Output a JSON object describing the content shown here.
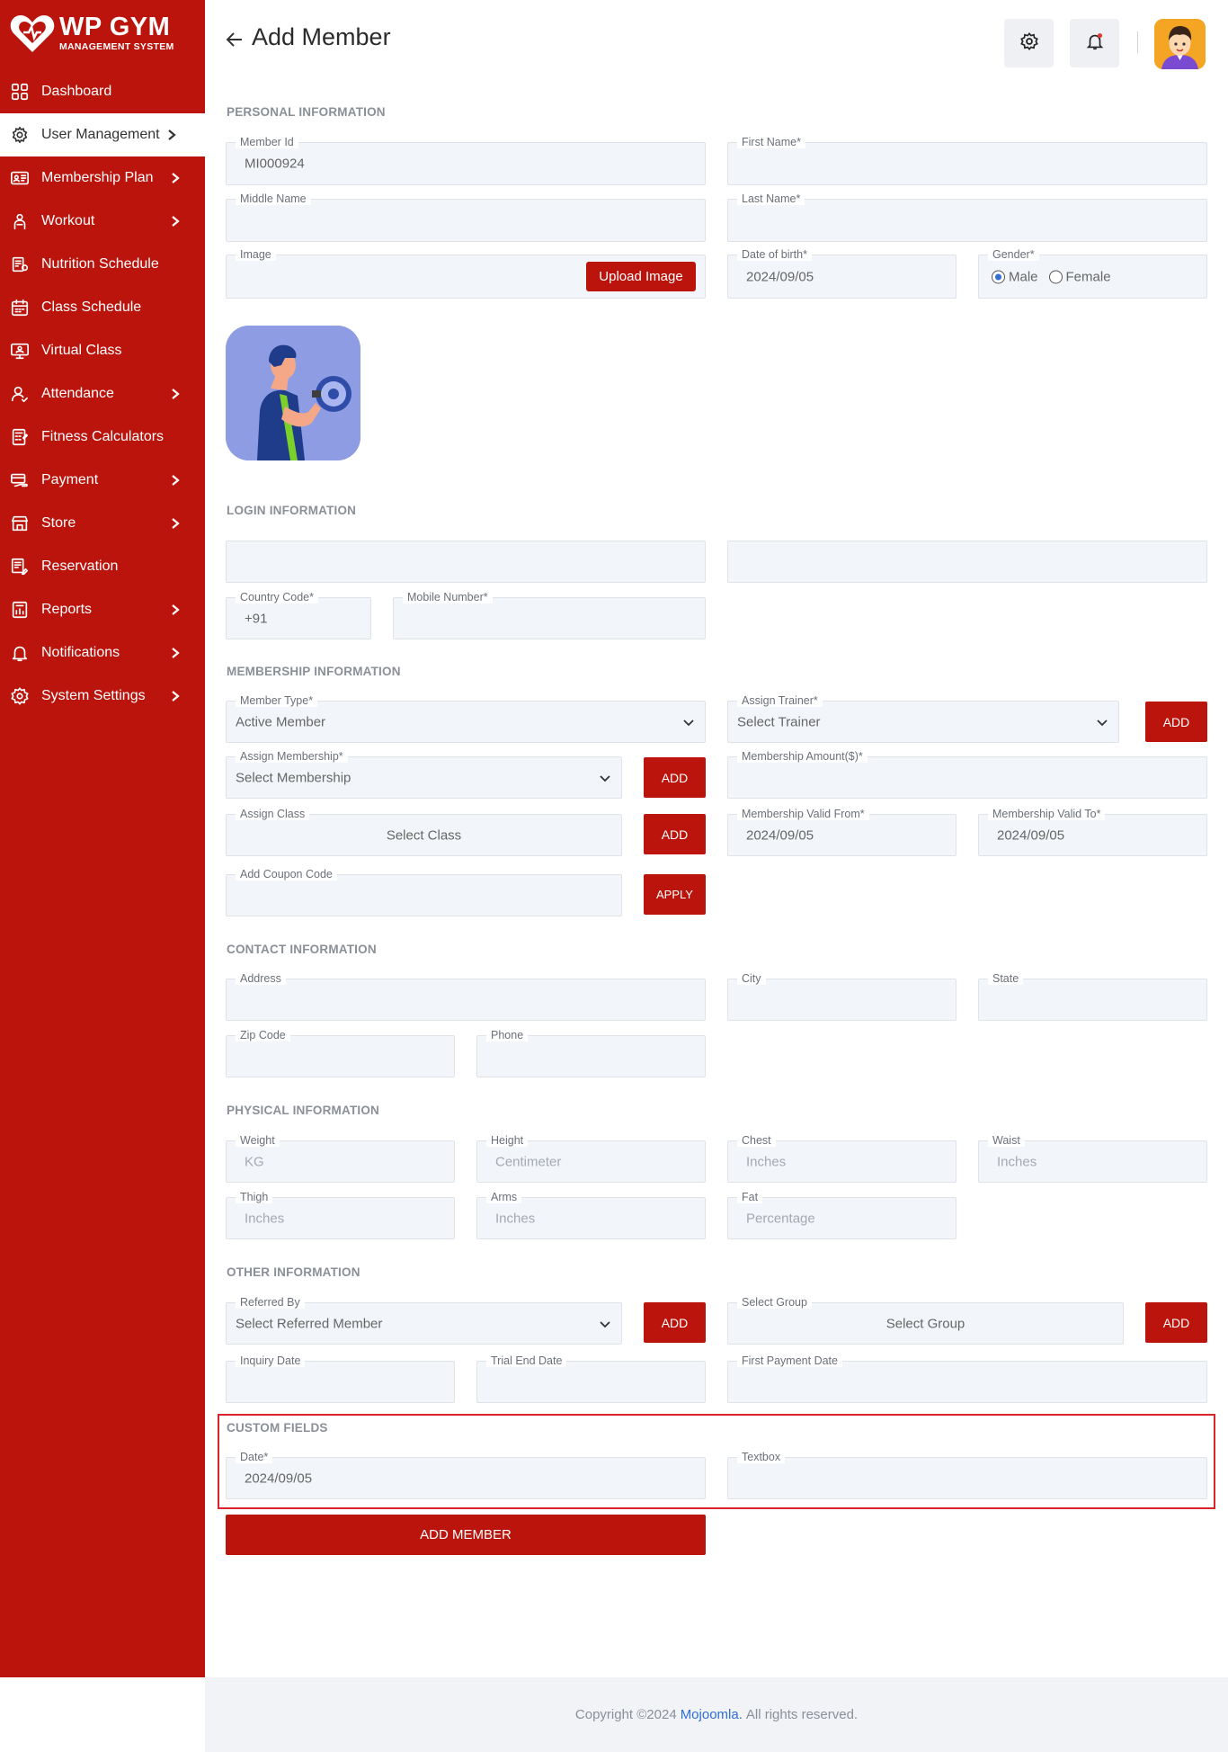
{
  "brand": {
    "title": "WP GYM",
    "subtitle": "MANAGEMENT SYSTEM"
  },
  "sidebar": {
    "items": [
      {
        "label": "Dashboard",
        "icon": "dashboard-icon",
        "chevron": false,
        "active": false
      },
      {
        "label": "User Management",
        "icon": "users-gear-icon",
        "chevron": true,
        "active": true
      },
      {
        "label": "Membership Plan",
        "icon": "membership-card-icon",
        "chevron": true,
        "active": false
      },
      {
        "label": "Workout",
        "icon": "workout-icon",
        "chevron": true,
        "active": false
      },
      {
        "label": "Nutrition Schedule",
        "icon": "nutrition-icon",
        "chevron": false,
        "active": false
      },
      {
        "label": "Class Schedule",
        "icon": "calendar-icon",
        "chevron": false,
        "active": false
      },
      {
        "label": "Virtual Class",
        "icon": "virtual-class-icon",
        "chevron": false,
        "active": false
      },
      {
        "label": "Attendance",
        "icon": "attendance-icon",
        "chevron": true,
        "active": false
      },
      {
        "label": "Fitness Calculators",
        "icon": "calculator-icon",
        "chevron": false,
        "active": false
      },
      {
        "label": "Payment",
        "icon": "payment-icon",
        "chevron": true,
        "active": false
      },
      {
        "label": "Store",
        "icon": "store-icon",
        "chevron": true,
        "active": false
      },
      {
        "label": "Reservation",
        "icon": "reservation-icon",
        "chevron": false,
        "active": false
      },
      {
        "label": "Reports",
        "icon": "reports-icon",
        "chevron": true,
        "active": false
      },
      {
        "label": "Notifications",
        "icon": "bell-icon",
        "chevron": true,
        "active": false
      },
      {
        "label": "System Settings",
        "icon": "settings-icon",
        "chevron": true,
        "active": false
      }
    ]
  },
  "header": {
    "title": "Add Member"
  },
  "colors": {
    "primary": "#ba140c",
    "field_bg": "#f2f5f9",
    "accent_blue": "#2f6fd6",
    "highlight_border": "#d8242a"
  },
  "sections": {
    "personal": "PERSONAL INFORMATION",
    "login": "LOGIN INFORMATION",
    "membership": "MEMBERSHIP INFORMATION",
    "contact": "CONTACT INFORMATION",
    "physical": "PHYSICAL INFORMATION",
    "other": "OTHER INFORMATION",
    "custom": "CUSTOM FIELDS"
  },
  "personal": {
    "member_id_label": "Member Id",
    "member_id_value": "MI000924",
    "first_name_label": "First Name*",
    "middle_name_label": "Middle Name",
    "last_name_label": "Last Name*",
    "image_label": "Image",
    "upload_button": "Upload Image",
    "dob_label": "Date of birth*",
    "dob_value": "2024/09/05",
    "gender_label": "Gender*",
    "gender_options": [
      "Male",
      "Female"
    ],
    "gender_selected": "Male"
  },
  "login": {
    "country_code_label": "Country Code*",
    "country_code_value": "+91",
    "mobile_label": "Mobile Number*"
  },
  "membership": {
    "member_type_label": "Member Type*",
    "member_type_value": "Active Member",
    "trainer_label": "Assign Trainer*",
    "trainer_value": "Select Trainer",
    "trainer_add": "ADD",
    "assign_membership_label": "Assign Membership*",
    "assign_membership_value": "Select Membership",
    "membership_add": "ADD",
    "amount_label": "Membership Amount($)*",
    "assign_class_label": "Assign Class",
    "assign_class_value": "Select Class",
    "class_add": "ADD",
    "valid_from_label": "Membership Valid From*",
    "valid_from_value": "2024/09/05",
    "valid_to_label": "Membership Valid To*",
    "valid_to_value": "2024/09/05",
    "coupon_label": "Add Coupon Code",
    "apply_button": "APPLY"
  },
  "contact": {
    "address_label": "Address",
    "city_label": "City",
    "state_label": "State",
    "zip_label": "Zip Code",
    "phone_label": "Phone"
  },
  "physical": {
    "weight_label": "Weight",
    "weight_placeholder": "KG",
    "height_label": "Height",
    "height_placeholder": "Centimeter",
    "chest_label": "Chest",
    "chest_placeholder": "Inches",
    "waist_label": "Waist",
    "waist_placeholder": "Inches",
    "thigh_label": "Thigh",
    "thigh_placeholder": "Inches",
    "arms_label": "Arms",
    "arms_placeholder": "Inches",
    "fat_label": "Fat",
    "fat_placeholder": "Percentage"
  },
  "other": {
    "referred_label": "Referred By",
    "referred_value": "Select Referred Member",
    "referred_add": "ADD",
    "group_label": "Select Group",
    "group_value": "Select Group",
    "group_add": "ADD",
    "inquiry_label": "Inquiry Date",
    "trial_end_label": "Trial End Date",
    "first_payment_label": "First Payment Date"
  },
  "custom": {
    "date_label": "Date*",
    "date_value": "2024/09/05",
    "textbox_label": "Textbox"
  },
  "submit_button": "ADD MEMBER",
  "footer": {
    "prefix": "Copyright ©2024",
    "brand": "Mojoomla.",
    "suffix": "All rights reserved."
  }
}
